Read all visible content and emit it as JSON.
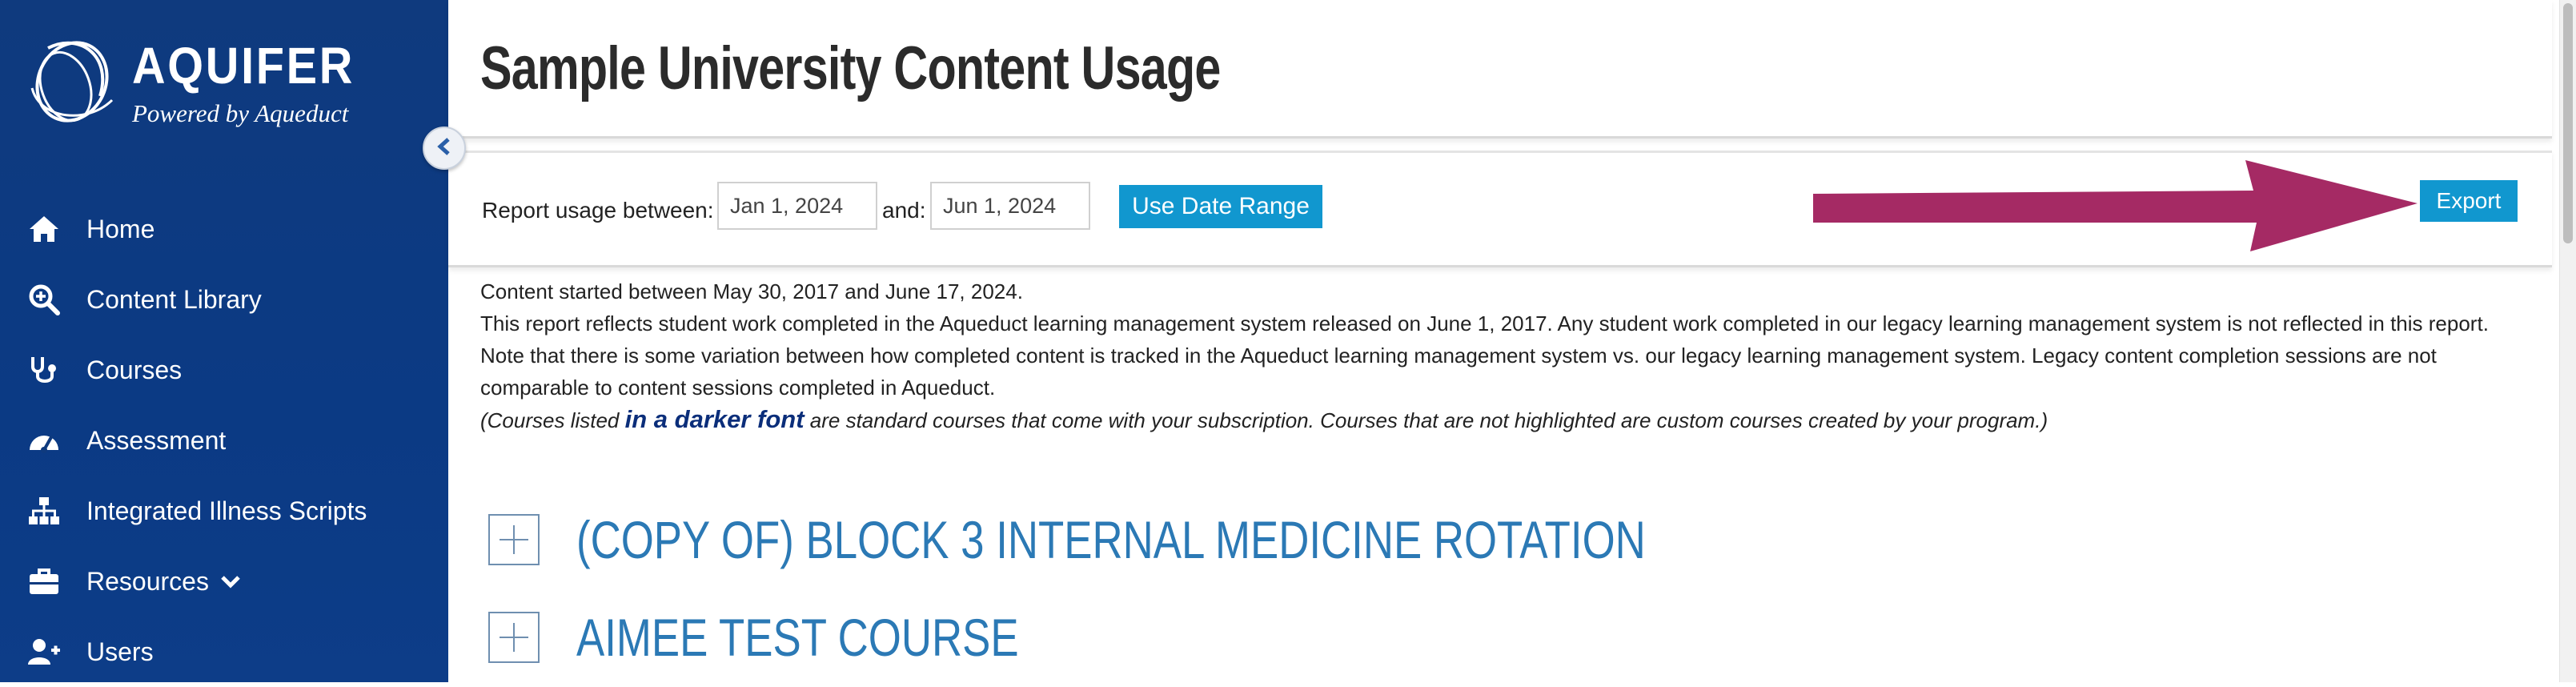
{
  "brand": {
    "name": "AQUIFER",
    "tagline": "Powered by Aqueduct"
  },
  "sidebar": {
    "items": [
      {
        "label": "Home",
        "icon": "home-icon"
      },
      {
        "label": "Content Library",
        "icon": "search-plus-icon"
      },
      {
        "label": "Courses",
        "icon": "stethoscope-icon"
      },
      {
        "label": "Assessment",
        "icon": "gauge-icon"
      },
      {
        "label": "Integrated Illness Scripts",
        "icon": "sitemap-icon"
      },
      {
        "label": "Resources",
        "icon": "briefcase-icon",
        "has_dropdown": true
      },
      {
        "label": "Users",
        "icon": "user-plus-icon"
      }
    ]
  },
  "page": {
    "title": "Sample University Content Usage"
  },
  "filter": {
    "label": "Report usage between:",
    "start_date": "Jan 1, 2024",
    "and_label": "and:",
    "end_date": "Jun 1, 2024",
    "apply_button": "Use Date Range",
    "export_button": "Export"
  },
  "info": {
    "line1": "Content started between May 30, 2017 and June 17, 2024.",
    "line2": "This report reflects student work completed in the Aqueduct learning management system released on June 1, 2017. Any student work completed in our legacy learning management system is not reflected in this report.",
    "line3": "Note that there is some variation between how completed content is tracked in the Aqueduct learning management system vs. our legacy learning management system. Legacy content completion sessions are not comparable to content sessions completed in Aqueduct.",
    "note_prefix": "(Courses listed ",
    "note_dark": "in a darker font",
    "note_suffix": " are standard courses that come with your subscription. Courses that are not highlighted are custom courses created by your program.)"
  },
  "courses": [
    {
      "title": "(COPY OF) BLOCK 3 INTERNAL MEDICINE ROTATION"
    },
    {
      "title": "AIMEE TEST COURSE"
    }
  ],
  "colors": {
    "sidebar": "#0f3a7e",
    "accent": "#1197cf",
    "arrow": "#a52a64",
    "course_title": "#2b79b5"
  }
}
